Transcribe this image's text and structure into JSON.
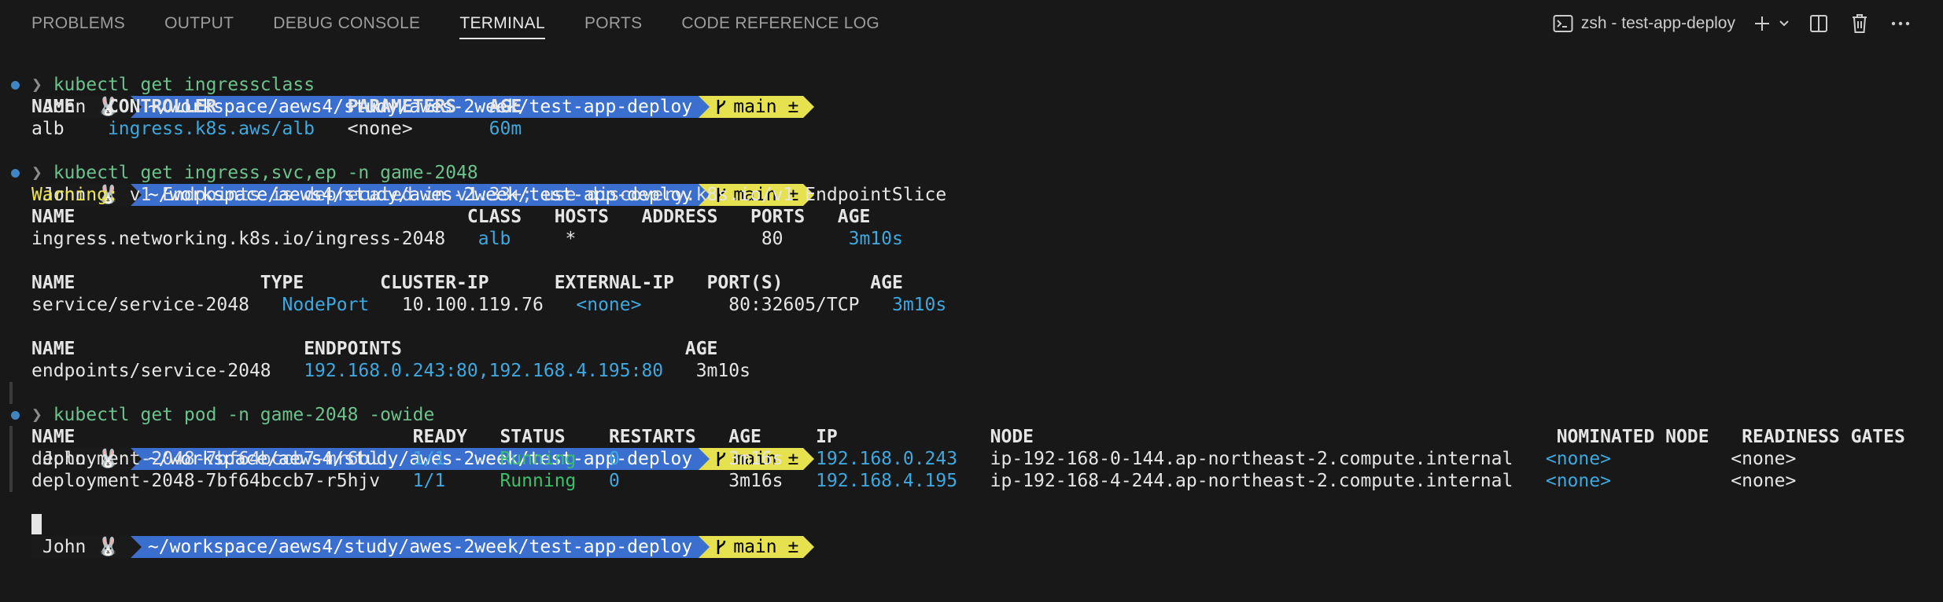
{
  "panel": {
    "tabs": [
      {
        "label": "PROBLEMS"
      },
      {
        "label": "OUTPUT"
      },
      {
        "label": "DEBUG CONSOLE"
      },
      {
        "label": "TERMINAL",
        "active": true
      },
      {
        "label": "PORTS"
      },
      {
        "label": "CODE REFERENCE LOG"
      }
    ],
    "terminal_name": "zsh - test-app-deploy",
    "icons": [
      "terminal-icon",
      "add-icon",
      "chevron-down-icon",
      "split-icon",
      "trash-icon",
      "more-icon"
    ]
  },
  "prompt": {
    "user": "John 🐰",
    "path": "~/workspace/aews4/study/awes-2week/test-app-deploy",
    "branch": "main ±"
  },
  "colors": {
    "path_bg": "#3a6fd0",
    "git_bg": "#e6e24f",
    "accent": "#3ea8df",
    "running": "#3dbf6a",
    "warning": "#ebe64c"
  },
  "terminal": {
    "cmd1": "kubectl get ingressclass",
    "ic_headers": {
      "name": "NAME",
      "controller": "CONTROLLER",
      "parameters": "PARAMETERS",
      "age": "AGE"
    },
    "ic_row": {
      "name": "alb",
      "controller": "ingress.k8s.aws/alb",
      "parameters": "<none>",
      "age": "60m"
    },
    "cmd2": "kubectl get ingress,svc,ep -n game-2048",
    "warning_label": "Warning:",
    "warning_text": " v1 Endpoints is deprecated in v1.33+; use discovery.k8s.io/v1 EndpointSlice",
    "ing_headers": {
      "name": "NAME",
      "class": "CLASS",
      "hosts": "HOSTS",
      "address": "ADDRESS",
      "ports": "PORTS",
      "age": "AGE"
    },
    "ing_row": {
      "name": "ingress.networking.k8s.io/ingress-2048",
      "class": "alb",
      "hosts": "*",
      "ports": "80",
      "age": "3m10s"
    },
    "svc_headers": {
      "name": "NAME",
      "type": "TYPE",
      "cluster_ip": "CLUSTER-IP",
      "external_ip": "EXTERNAL-IP",
      "ports": "PORT(S)",
      "age": "AGE"
    },
    "svc_row": {
      "name": "service/service-2048",
      "type": "NodePort",
      "cluster_ip": "10.100.119.76",
      "external_ip": "<none>",
      "ports": "80:32605/TCP",
      "age": "3m10s"
    },
    "ep_headers": {
      "name": "NAME",
      "endpoints": "ENDPOINTS",
      "age": "AGE"
    },
    "ep_row": {
      "name": "endpoints/service-2048",
      "endpoints": "192.168.0.243:80,192.168.4.195:80",
      "age": "3m10s"
    },
    "cmd3": "kubectl get pod -n game-2048 -owide",
    "pod_headers": {
      "name": "NAME",
      "ready": "READY",
      "status": "STATUS",
      "restarts": "RESTARTS",
      "age": "AGE",
      "ip": "IP",
      "node": "NODE",
      "nominated": "NOMINATED NODE",
      "gates": "READINESS GATES"
    },
    "pods": [
      {
        "name": "deployment-2048-7bf64bccb7-mr6bl",
        "ready": "1/1",
        "status": "Running",
        "restarts": "0",
        "age": "3m16s",
        "ip": "192.168.0.243",
        "node": "ip-192-168-0-144.ap-northeast-2.compute.internal",
        "nominated": "<none>",
        "gates": "<none>"
      },
      {
        "name": "deployment-2048-7bf64bccb7-r5hjv",
        "ready": "1/1",
        "status": "Running",
        "restarts": "0",
        "age": "3m16s",
        "ip": "192.168.4.195",
        "node": "ip-192-168-4-244.ap-northeast-2.compute.internal",
        "nominated": "<none>",
        "gates": "<none>"
      }
    ]
  }
}
